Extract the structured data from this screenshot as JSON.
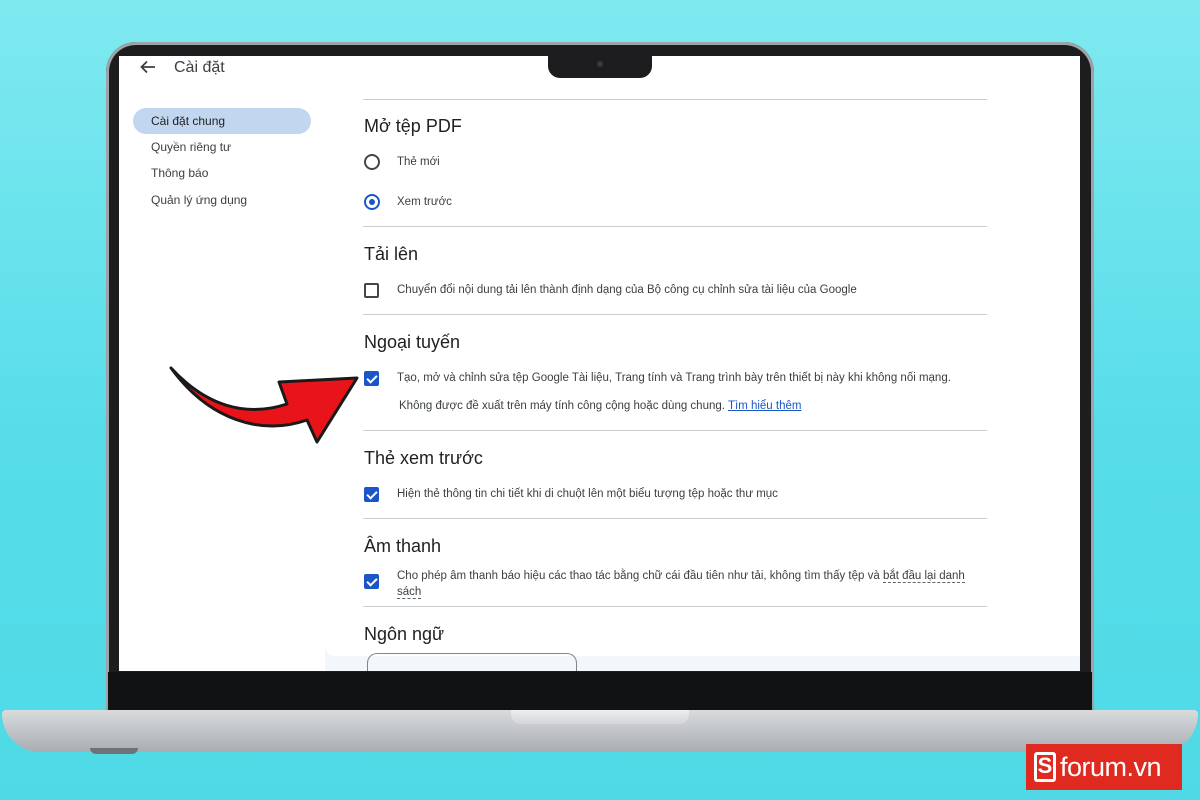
{
  "app": {
    "title": "Cài đặt",
    "back_icon": "arrow-left-icon"
  },
  "sidebar": {
    "items": [
      {
        "label": "Cài đặt chung",
        "active": true
      },
      {
        "label": "Quyền riêng tư",
        "active": false
      },
      {
        "label": "Thông báo",
        "active": false
      },
      {
        "label": "Quản lý ứng dụng",
        "active": false
      }
    ]
  },
  "sections": {
    "open_pdf": {
      "title": "Mở tệp PDF",
      "options": [
        {
          "label": "Thẻ mới",
          "selected": false
        },
        {
          "label": "Xem trước",
          "selected": true
        }
      ]
    },
    "upload": {
      "title": "Tải lên",
      "option": {
        "label": "Chuyển đổi nội dung tải lên thành định dạng của Bộ công cụ chỉnh sửa tài liệu của Google",
        "checked": false
      }
    },
    "offline": {
      "title": "Ngoại tuyến",
      "option": {
        "label": "Tạo, mở và chỉnh sửa tệp Google Tài liệu, Trang tính và Trang trình bày trên thiết bị này khi không nối mạng.",
        "checked": true
      },
      "note": "Không được đề xuất trên máy tính công cộng hoặc dùng chung.",
      "link": "Tìm hiểu thêm"
    },
    "preview_cards": {
      "title": "Thẻ xem trước",
      "option": {
        "label": "Hiện thẻ thông tin chi tiết khi di chuột lên một biểu tượng tệp hoặc thư mục",
        "checked": true
      }
    },
    "sound": {
      "title": "Âm thanh",
      "option": {
        "label_part1": "Cho phép âm thanh báo hiệu các thao tác bằng chữ cái đầu tiên như tải, không tìm thấy tệp và ",
        "label_part2": "bắt đầu lại danh",
        "label_part3": "sách",
        "checked": true
      }
    },
    "language": {
      "title": "Ngôn ngữ"
    }
  },
  "badge": {
    "logo_letter": "S",
    "text": "forum.vn"
  },
  "colors": {
    "accent": "#1a56c8",
    "active_nav": "#c2d7ef",
    "arrow": "#e8141a",
    "badge": "#e02a1f"
  }
}
